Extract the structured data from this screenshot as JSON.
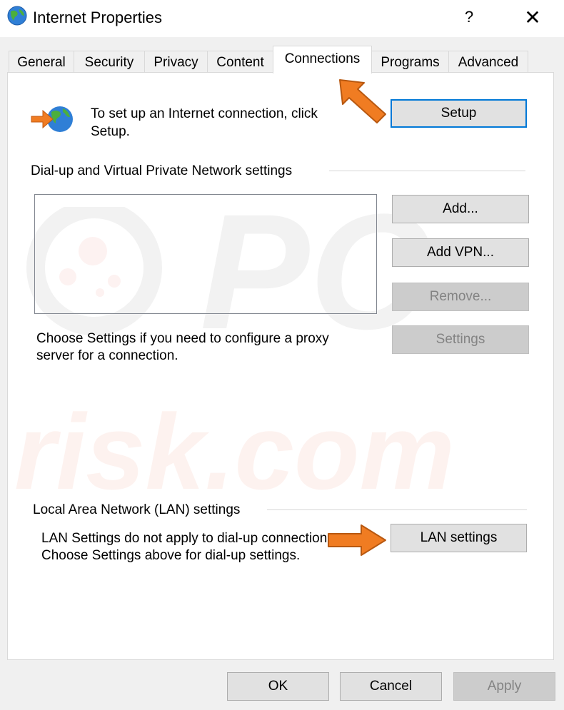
{
  "window": {
    "title": "Internet Properties",
    "help": "?",
    "close": "✕"
  },
  "tabs": [
    {
      "label": "General"
    },
    {
      "label": "Security"
    },
    {
      "label": "Privacy"
    },
    {
      "label": "Content"
    },
    {
      "label": "Connections",
      "active": true
    },
    {
      "label": "Programs"
    },
    {
      "label": "Advanced"
    }
  ],
  "setup": {
    "text_line1": "To set up an Internet connection, click",
    "text_line2": "Setup.",
    "button": "Setup"
  },
  "dialup": {
    "heading": "Dial-up and Virtual Private Network settings",
    "add_button": "Add...",
    "add_vpn_button": "Add VPN...",
    "remove_button": "Remove...",
    "settings_button": "Settings",
    "proxy_line1": "Choose Settings if you need to configure a proxy",
    "proxy_line2": "server for a connection."
  },
  "lan": {
    "heading": "Local Area Network (LAN) settings",
    "text_line1": "LAN Settings do not apply to dial-up connections.",
    "text_line2": "Choose Settings above for dial-up settings.",
    "button": "LAN settings"
  },
  "footer": {
    "ok": "OK",
    "cancel": "Cancel",
    "apply": "Apply"
  },
  "watermark": {
    "line1": "PC",
    "line2": "risk.com"
  },
  "colors": {
    "accent": "#0078d7",
    "arrow": "#f07c22",
    "panel": "#ffffff",
    "chrome": "#f0f0f0"
  }
}
